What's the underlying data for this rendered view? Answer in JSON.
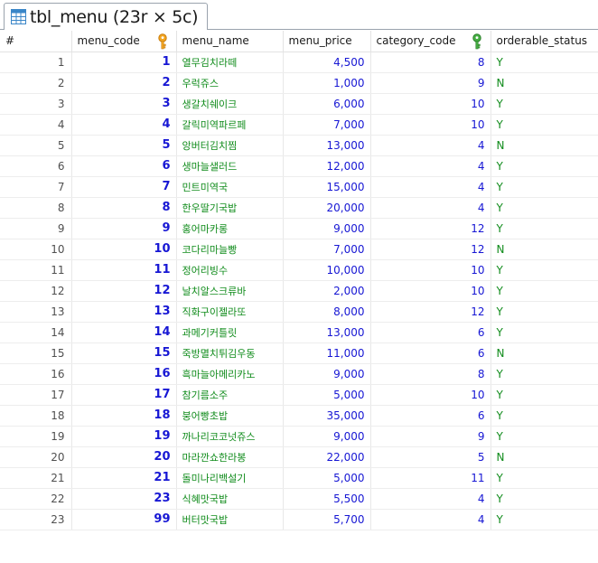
{
  "tab": {
    "title": "tbl_menu (23r × 5c)",
    "icon": "table-grid-icon"
  },
  "columns": {
    "rownum": "#",
    "menu_code": "menu_code",
    "menu_name": "menu_name",
    "menu_price": "menu_price",
    "category_code": "category_code",
    "orderable_status": "orderable_status"
  },
  "key_icons": {
    "primary": "primary-key-icon",
    "foreign": "foreign-key-icon"
  },
  "colors": {
    "number": "#1717d4",
    "text": "#118c1c",
    "primary_key": "#f0a020",
    "foreign_key": "#3da13a"
  },
  "rows": [
    {
      "n": "1",
      "code": "1",
      "name": "열무김치라떼",
      "price": "4,500",
      "cat": "8",
      "status": "Y"
    },
    {
      "n": "2",
      "code": "2",
      "name": "우럭쥬스",
      "price": "1,000",
      "cat": "9",
      "status": "N"
    },
    {
      "n": "3",
      "code": "3",
      "name": "생갈치쉐이크",
      "price": "6,000",
      "cat": "10",
      "status": "Y"
    },
    {
      "n": "4",
      "code": "4",
      "name": "갈릭미역파르페",
      "price": "7,000",
      "cat": "10",
      "status": "Y"
    },
    {
      "n": "5",
      "code": "5",
      "name": "앙버터김치찜",
      "price": "13,000",
      "cat": "4",
      "status": "N"
    },
    {
      "n": "6",
      "code": "6",
      "name": "생마늘샐러드",
      "price": "12,000",
      "cat": "4",
      "status": "Y"
    },
    {
      "n": "7",
      "code": "7",
      "name": "민트미역국",
      "price": "15,000",
      "cat": "4",
      "status": "Y"
    },
    {
      "n": "8",
      "code": "8",
      "name": "한우딸기국밥",
      "price": "20,000",
      "cat": "4",
      "status": "Y"
    },
    {
      "n": "9",
      "code": "9",
      "name": "홍어마카롱",
      "price": "9,000",
      "cat": "12",
      "status": "Y"
    },
    {
      "n": "10",
      "code": "10",
      "name": "코다리마늘빵",
      "price": "7,000",
      "cat": "12",
      "status": "N"
    },
    {
      "n": "11",
      "code": "11",
      "name": "정어리빙수",
      "price": "10,000",
      "cat": "10",
      "status": "Y"
    },
    {
      "n": "12",
      "code": "12",
      "name": "날치알스크류바",
      "price": "2,000",
      "cat": "10",
      "status": "Y"
    },
    {
      "n": "13",
      "code": "13",
      "name": "직화구이젤라또",
      "price": "8,000",
      "cat": "12",
      "status": "Y"
    },
    {
      "n": "14",
      "code": "14",
      "name": "과메기커틀릿",
      "price": "13,000",
      "cat": "6",
      "status": "Y"
    },
    {
      "n": "15",
      "code": "15",
      "name": "죽방멸치튀김우동",
      "price": "11,000",
      "cat": "6",
      "status": "N"
    },
    {
      "n": "16",
      "code": "16",
      "name": "흑마늘아메리카노",
      "price": "9,000",
      "cat": "8",
      "status": "Y"
    },
    {
      "n": "17",
      "code": "17",
      "name": "참기름소주",
      "price": "5,000",
      "cat": "10",
      "status": "Y"
    },
    {
      "n": "18",
      "code": "18",
      "name": "붕어빵초밥",
      "price": "35,000",
      "cat": "6",
      "status": "Y"
    },
    {
      "n": "19",
      "code": "19",
      "name": "까나리코코넛쥬스",
      "price": "9,000",
      "cat": "9",
      "status": "Y"
    },
    {
      "n": "20",
      "code": "20",
      "name": "마라깐쇼한라봉",
      "price": "22,000",
      "cat": "5",
      "status": "N"
    },
    {
      "n": "21",
      "code": "21",
      "name": "돌미나리백설기",
      "price": "5,000",
      "cat": "11",
      "status": "Y"
    },
    {
      "n": "22",
      "code": "23",
      "name": "식혜맛국밥",
      "price": "5,500",
      "cat": "4",
      "status": "Y"
    },
    {
      "n": "23",
      "code": "99",
      "name": "버터맛국밥",
      "price": "5,700",
      "cat": "4",
      "status": "Y"
    }
  ]
}
